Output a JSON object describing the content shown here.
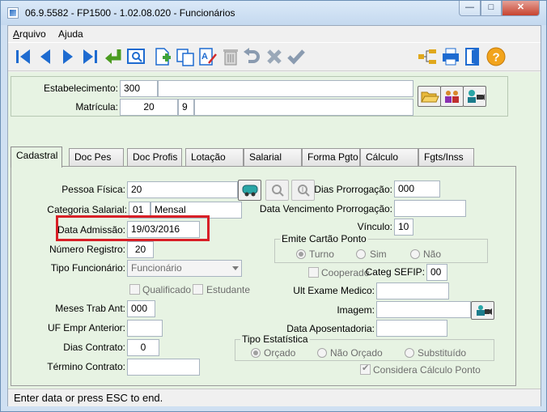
{
  "window": {
    "title": "06.9.5582 - FP1500 - 1.02.08.020 - Funcionários",
    "controls": {
      "minimize": "—",
      "maximize": "□",
      "close": "✕"
    }
  },
  "menu": [
    {
      "label": "Arquivo",
      "mnemonic": "A",
      "rest": "rquivo"
    },
    {
      "label": "Ajuda",
      "mnemonic": "j",
      "pre": "A",
      "rest": "uda"
    }
  ],
  "toolbar": {
    "icons": [
      "first-record-icon",
      "previous-record-icon",
      "next-record-icon",
      "last-record-icon",
      "return-icon",
      "preview-icon",
      "new-record-icon",
      "copy-icon",
      "edit-icon",
      "delete-icon",
      "undo-icon",
      "cancel-icon",
      "confirm-icon",
      "tree-icon",
      "print-icon",
      "exit-door-icon",
      "help-icon"
    ]
  },
  "header": {
    "estabelecimento_label": "Estabelecimento:",
    "estabelecimento_code": "300",
    "estabelecimento_name": "",
    "matricula_label": "Matrícula:",
    "matricula_number": "20",
    "matricula_digit": "9",
    "matricula_name": ""
  },
  "tabs": [
    "Cadastral",
    "Doc Pes",
    "Doc Profis",
    "Lotação",
    "Salarial",
    "Forma Pgto",
    "Cálculo",
    "Fgts/Inss"
  ],
  "form": {
    "pessoa_fisica_label": "Pessoa Física:",
    "pessoa_fisica_value": "20",
    "dias_prorrogacao_label": "Dias Prorrogação:",
    "dias_prorrogacao_value": "000",
    "categoria_salarial_label": "Categoria Salarial:",
    "categoria_salarial_code": "01",
    "categoria_salarial_name": "Mensal",
    "data_vencimento_prorrogacao_label": "Data Vencimento Prorrogação:",
    "data_vencimento_prorrogacao_value": "",
    "data_admissao_label": "Data Admissão:",
    "data_admissao_value": "19/03/2016",
    "vinculo_label": "Vínculo:",
    "vinculo_value": "10",
    "numero_registro_label": "Número Registro:",
    "numero_registro_value": "20",
    "emite_cartao_ponto_label": "Emite Cartão Ponto",
    "emite_cartao_options": [
      {
        "label": "Turno",
        "selected": true
      },
      {
        "label": "Sim",
        "selected": false
      },
      {
        "label": "Não",
        "selected": false
      }
    ],
    "tipo_funcionario_label": "Tipo Funcionário:",
    "tipo_funcionario_value": "Funcionário",
    "cooperado_label": "Cooperado",
    "categ_sefip_label": "Categ SEFIP:",
    "categ_sefip_value": "00",
    "qualificado_label": "Qualificado",
    "estudante_label": "Estudante",
    "ult_exame_medico_label": "Ult Exame Medico:",
    "ult_exame_medico_value": "",
    "meses_trab_ant_label": "Meses Trab Ant:",
    "meses_trab_ant_value": "000",
    "imagem_label": "Imagem:",
    "imagem_value": "",
    "uf_empr_anterior_label": "UF Empr Anterior:",
    "uf_empr_anterior_value": "",
    "data_aposentadoria_label": "Data Aposentadoria:",
    "data_aposentadoria_value": "",
    "dias_contrato_label": "Dias Contrato:",
    "dias_contrato_value": "0",
    "tipo_estatistica_label": "Tipo Estatística",
    "tipo_estatistica_options": [
      {
        "label": "Orçado",
        "selected": true
      },
      {
        "label": "Não Orçado",
        "selected": false
      },
      {
        "label": "Substituído",
        "selected": false
      }
    ],
    "termino_contrato_label": "Término Contrato:",
    "termino_contrato_value": "",
    "considera_calculo_ponto_label": "Considera Cálculo Ponto"
  },
  "status": {
    "text": "Enter data or press ESC to end."
  }
}
